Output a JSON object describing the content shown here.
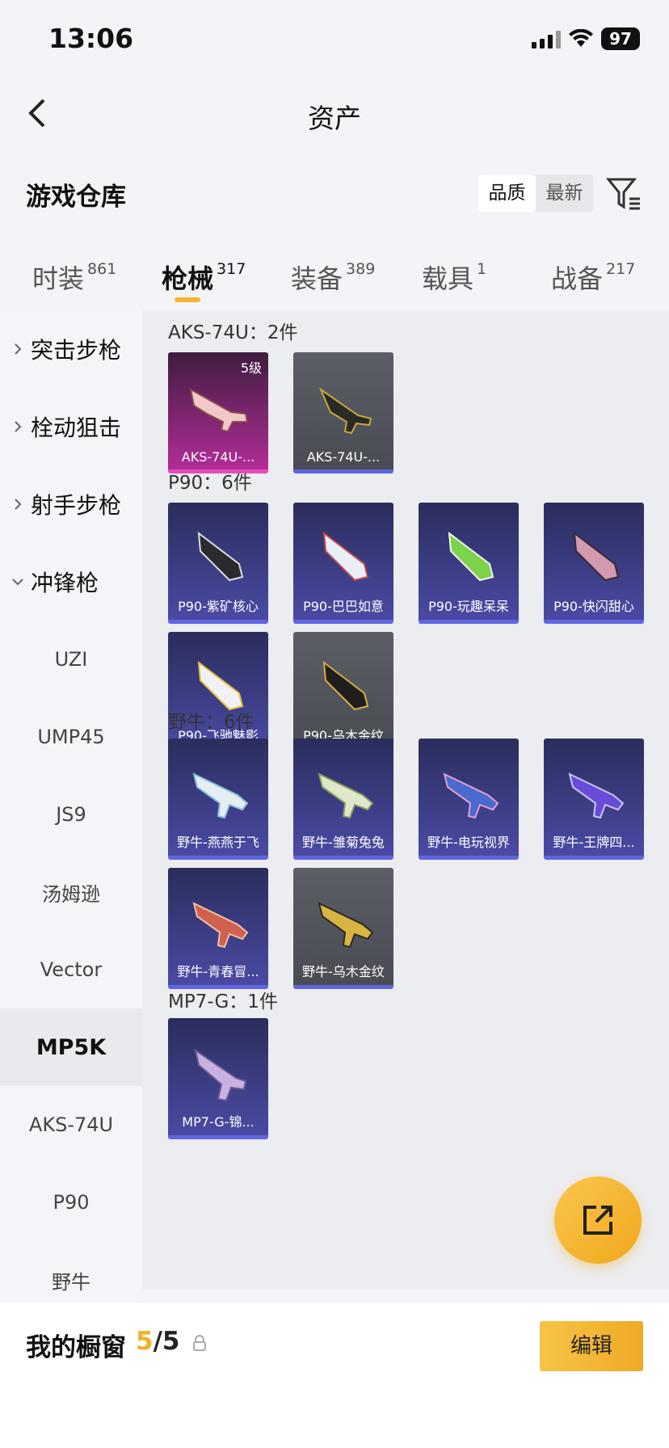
{
  "status_bar": {
    "time": "13:06",
    "battery": "97"
  },
  "nav": {
    "title": "资产"
  },
  "section": {
    "title": "游戏仓库",
    "sort_options": [
      "品质",
      "最新"
    ],
    "active_sort": "品质"
  },
  "tabs": [
    {
      "label": "时装",
      "count": "861"
    },
    {
      "label": "枪械",
      "count": "317"
    },
    {
      "label": "装备",
      "count": "389"
    },
    {
      "label": "载具",
      "count": "1"
    },
    {
      "label": "战备",
      "count": "217"
    }
  ],
  "sidebar": {
    "categories": [
      "突击步枪",
      "栓动狙击",
      "射手步枪",
      "冲锋枪"
    ],
    "subs": [
      "UZI",
      "UMP45",
      "JS9",
      "汤姆逊",
      "Vector",
      "MP5K",
      "AKS-74U",
      "P90",
      "野牛"
    ]
  },
  "groups": [
    {
      "title": "AKS-74U：2件",
      "items": [
        {
          "name": "AKS-74U-...",
          "level": "5级"
        },
        {
          "name": "AKS-74U-..."
        }
      ]
    },
    {
      "title": "P90：6件",
      "items": [
        {
          "name": "P90-紫矿核心"
        },
        {
          "name": "P90-巴巴如意"
        },
        {
          "name": "P90-玩趣呆呆"
        },
        {
          "name": "P90-快闪甜心"
        },
        {
          "name": "P90-飞驰魅影"
        },
        {
          "name": "P90-乌木金纹"
        }
      ]
    },
    {
      "title": "野牛：6件",
      "items": [
        {
          "name": "野牛-燕燕于飞"
        },
        {
          "name": "野牛-雏菊兔兔"
        },
        {
          "name": "野牛-电玩视界"
        },
        {
          "name": "野牛-王牌四..."
        },
        {
          "name": "野牛-青春冒..."
        },
        {
          "name": "野牛-乌木金纹"
        }
      ]
    },
    {
      "title": "MP7-G：1件",
      "items": [
        {
          "name": "MP7-G-锦..."
        }
      ]
    }
  ],
  "bottom": {
    "label": "我的橱窗",
    "count_current": "5",
    "count_total": "/5",
    "edit_label": "编辑"
  },
  "colors": {
    "accent": "#f3b024",
    "card_dark": "#2b2d5c",
    "card_grey": "#53555c",
    "card_pink": "#b32c97"
  }
}
